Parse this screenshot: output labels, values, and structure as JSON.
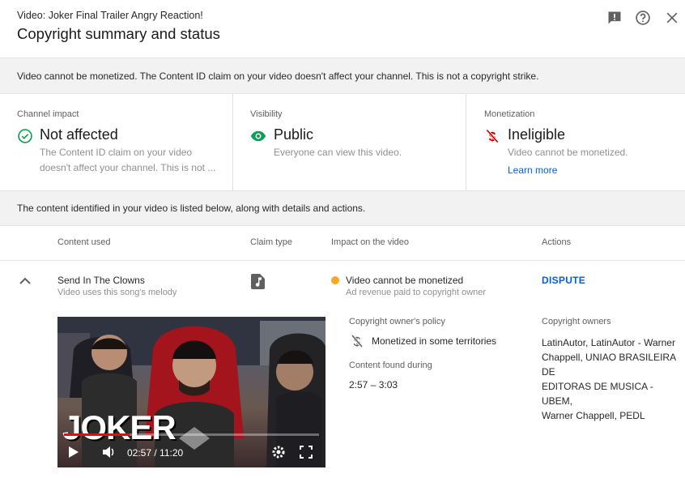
{
  "header": {
    "video_label": "Video: Joker Final Trailer Angry Reaction!",
    "title": "Copyright summary and status",
    "icons": [
      "feedback-icon",
      "help-icon",
      "close-icon"
    ]
  },
  "banner": {
    "text": "Video cannot be monetized. The Content ID claim on your video doesn't affect your channel. This is not a copyright strike."
  },
  "cards": {
    "channel_impact": {
      "label": "Channel impact",
      "value": "Not affected",
      "desc_line1": "The Content ID claim on your video",
      "desc_line2": "doesn't affect your channel. This is not ..."
    },
    "visibility": {
      "label": "Visibility",
      "value": "Public",
      "desc": "Everyone can view this video."
    },
    "monetization": {
      "label": "Monetization",
      "value": "Ineligible",
      "desc": "Video cannot be monetized.",
      "link": "Learn more"
    }
  },
  "identified": {
    "text": "The content identified in your video is listed below, along with details and actions."
  },
  "table": {
    "headers": [
      "Content used",
      "Claim type",
      "Impact on the video",
      "Actions"
    ]
  },
  "claim": {
    "title": "Send In The Clowns",
    "subtitle": "Video uses this song's melody",
    "impact": "Video cannot be monetized",
    "impact_sub": "Ad revenue paid to copyright owner",
    "action": "DISPUTE",
    "policy_label": "Copyright owner's policy",
    "policy_value": "Monetized in some territories",
    "found_label": "Content found during",
    "found_value": "2:57 – 3:03",
    "owners_label": "Copyright owners",
    "owners_lines": [
      "LatinAutor, LatinAutor - Warner",
      "Chappell, UNIAO BRASILEIRA DE",
      "EDITORAS DE MUSICA - UBEM,",
      "Warner Chappell, PEDL"
    ]
  },
  "player": {
    "overlay_text": "JOKER",
    "time": "02:57 / 11:20",
    "progress": 0.256
  },
  "colors": {
    "green": "#0f9d58",
    "red": "#cc0000",
    "orange": "#f9a825",
    "link": "#065fd4"
  }
}
